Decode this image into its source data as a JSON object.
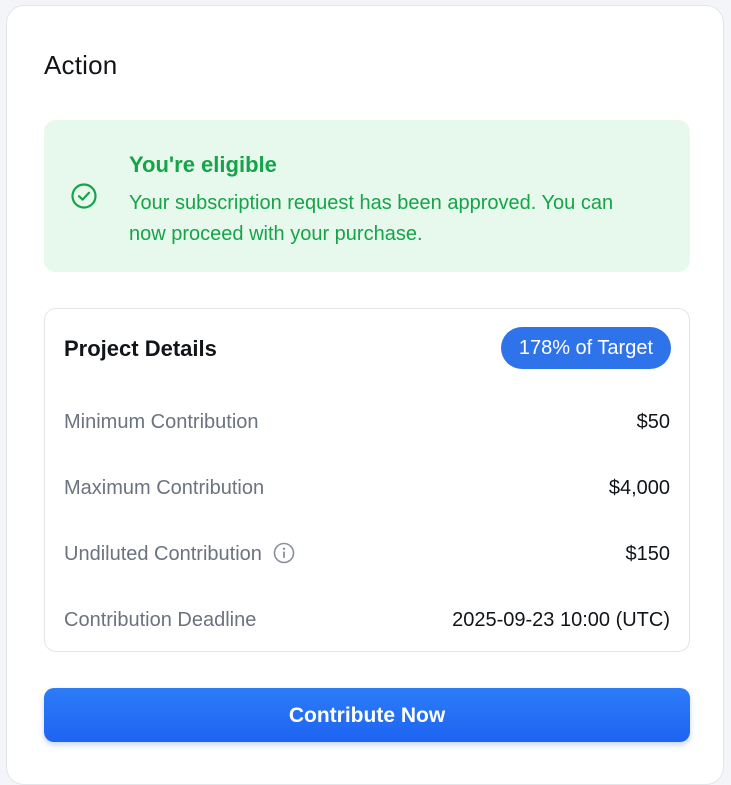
{
  "section": {
    "title": "Action"
  },
  "eligibility": {
    "icon": "check-circle-icon",
    "color": "#16a34a",
    "background": "#e7f8ec",
    "title": "You're eligible",
    "message": "Your subscription request has been approved. You can now proceed with your purchase."
  },
  "project_details": {
    "title": "Project Details",
    "target_badge": "178% of Target",
    "badge_color": "#2f73ea",
    "rows": [
      {
        "label": "Minimum Contribution",
        "value": "$50"
      },
      {
        "label": "Maximum Contribution",
        "value": "$4,000"
      },
      {
        "label": "Undiluted Contribution",
        "value": "$150",
        "icon": "info-icon"
      },
      {
        "label": "Contribution Deadline",
        "value": "2025-09-23 10:00 (UTC)"
      }
    ]
  },
  "cta": {
    "label": "Contribute Now",
    "color": "#1e64f2"
  }
}
